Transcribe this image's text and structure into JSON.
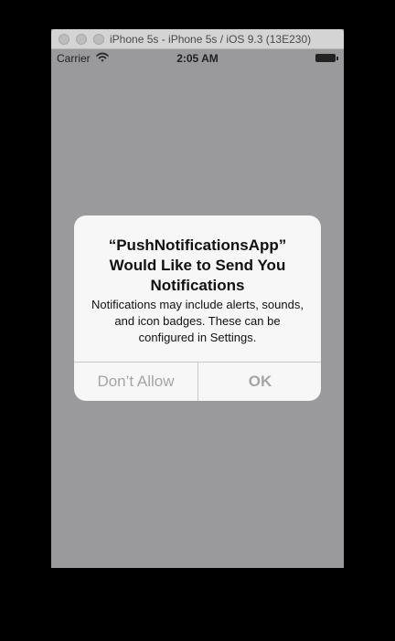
{
  "window": {
    "title": "iPhone 5s - iPhone 5s / iOS 9.3 (13E230)"
  },
  "status_bar": {
    "carrier": "Carrier",
    "time": "2:05 AM"
  },
  "alert": {
    "title": "“PushNotificationsApp” Would Like to Send You Notifications",
    "message": "Notifications may include alerts, sounds, and icon badges. These can be configured in Settings.",
    "buttons": {
      "deny": "Don’t Allow",
      "allow": "OK"
    }
  },
  "colors": {
    "background": "#000000",
    "screen_dim": "#9a999b",
    "alert_background": "#f7f7f8",
    "button_text": "#a5a5a7"
  }
}
